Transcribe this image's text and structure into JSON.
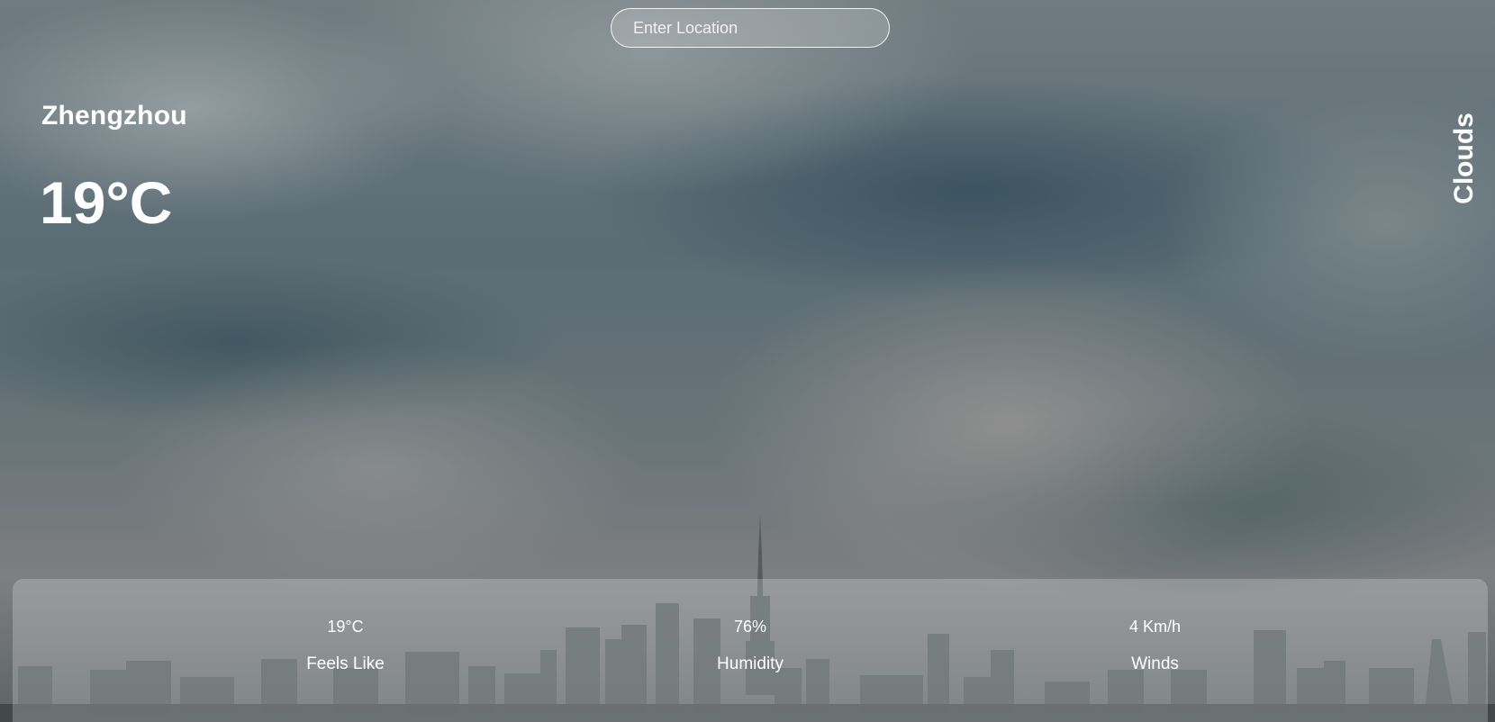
{
  "search": {
    "placeholder": "Enter Location"
  },
  "weather": {
    "city": "Zhengzhou",
    "temperature": "19°C",
    "description": "Clouds"
  },
  "stats": [
    {
      "value": "19°C",
      "label": "Feels Like"
    },
    {
      "value": "76%",
      "label": "Humidity"
    },
    {
      "value": "4 Km/h",
      "label": "Winds"
    }
  ]
}
